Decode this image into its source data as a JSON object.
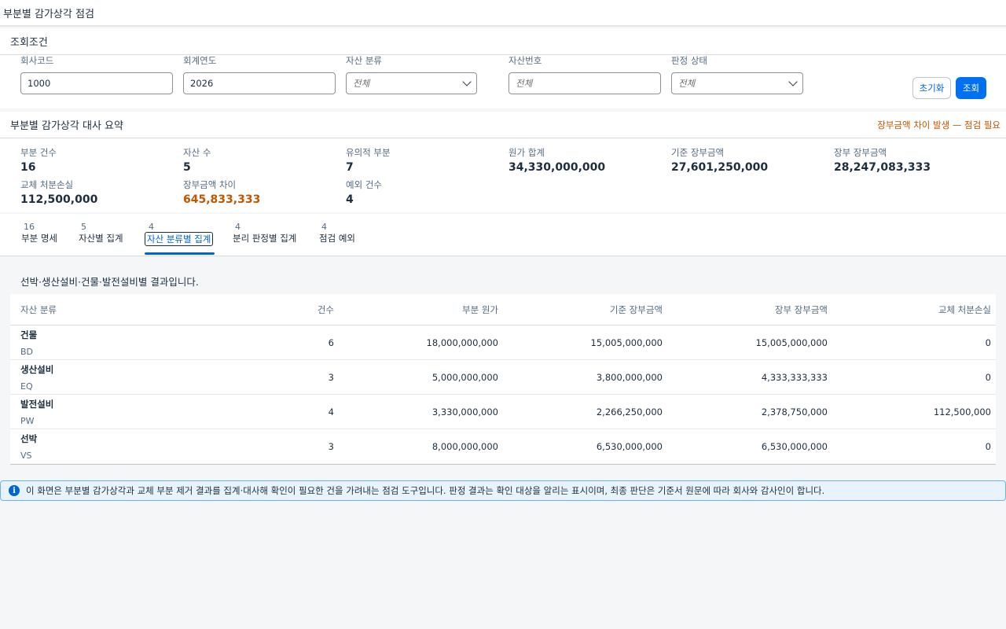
{
  "page": {
    "title": "부분별 감가상각 점검"
  },
  "filters": {
    "title": "조회조건",
    "company_code": {
      "label": "회사코드",
      "value": "1000"
    },
    "fiscal_year": {
      "label": "회계연도",
      "value": "2026"
    },
    "asset_class": {
      "label": "자산 분류",
      "value": "전체"
    },
    "asset_number": {
      "label": "자산번호",
      "placeholder": "전체"
    },
    "judgment_status": {
      "label": "판정 상태",
      "value": "전체"
    },
    "reset_label": "초기화",
    "search_label": "조회"
  },
  "summary": {
    "title": "부분별 감가상각 대사 요약",
    "warning": "장부금액 차이 발생 — 점검 필요",
    "kpis": [
      {
        "label": "부분 건수",
        "value": "16"
      },
      {
        "label": "자산 수",
        "value": "5"
      },
      {
        "label": "유의적 부분",
        "value": "7"
      },
      {
        "label": "원가 합계",
        "value": "34,330,000,000"
      },
      {
        "label": "기준 장부금액",
        "value": "27,601,250,000"
      },
      {
        "label": "장부 장부금액",
        "value": "28,247,083,333"
      },
      {
        "label": "교체 처분손실",
        "value": "112,500,000"
      },
      {
        "label": "장부금액 차이",
        "value": "645,833,333"
      },
      {
        "label": "예외 건수",
        "value": "4"
      }
    ]
  },
  "tabs": [
    {
      "count": "16",
      "label": "부분 명세"
    },
    {
      "count": "5",
      "label": "자산별 집계"
    },
    {
      "count": "4",
      "label": "자산 분류별 집계"
    },
    {
      "count": "4",
      "label": "분리 판정별 집계"
    },
    {
      "count": "4",
      "label": "점검 예외"
    }
  ],
  "content": {
    "description": "선박·생산설비·건물·발전설비별 결과입니다.",
    "columns": [
      "자산 분류",
      "건수",
      "부분 원가",
      "기준 장부금액",
      "장부 장부금액",
      "교체 처분손실"
    ],
    "rows": [
      {
        "name": "건물",
        "code": "BD",
        "count": "6",
        "cost": "18,000,000,000",
        "base_book": "15,005,000,000",
        "ledger_book": "15,005,000,000",
        "loss": "0"
      },
      {
        "name": "생산설비",
        "code": "EQ",
        "count": "3",
        "cost": "5,000,000,000",
        "base_book": "3,800,000,000",
        "ledger_book": "4,333,333,333",
        "loss": "0"
      },
      {
        "name": "발전설비",
        "code": "PW",
        "count": "4",
        "cost": "3,330,000,000",
        "base_book": "2,266,250,000",
        "ledger_book": "2,378,750,000",
        "loss": "112,500,000"
      },
      {
        "name": "선박",
        "code": "VS",
        "count": "3",
        "cost": "8,000,000,000",
        "base_book": "6,530,000,000",
        "ledger_book": "6,530,000,000",
        "loss": "0"
      }
    ]
  },
  "info": {
    "icon": "info-icon",
    "text": "이 화면은 부분별 감가상각과 교체 부분 제거 결과를 집계·대사해 확인이 필요한 건을 가려내는 점검 도구입니다. 판정 결과는 확인 대상을 알리는 표시이며, 최종 판단은 기준서 원문에 따라 회사와 감사인이 합니다."
  },
  "colors": {
    "accent": "#0070f2",
    "critical": "#c35500",
    "info_bg": "#e8f4fd"
  }
}
